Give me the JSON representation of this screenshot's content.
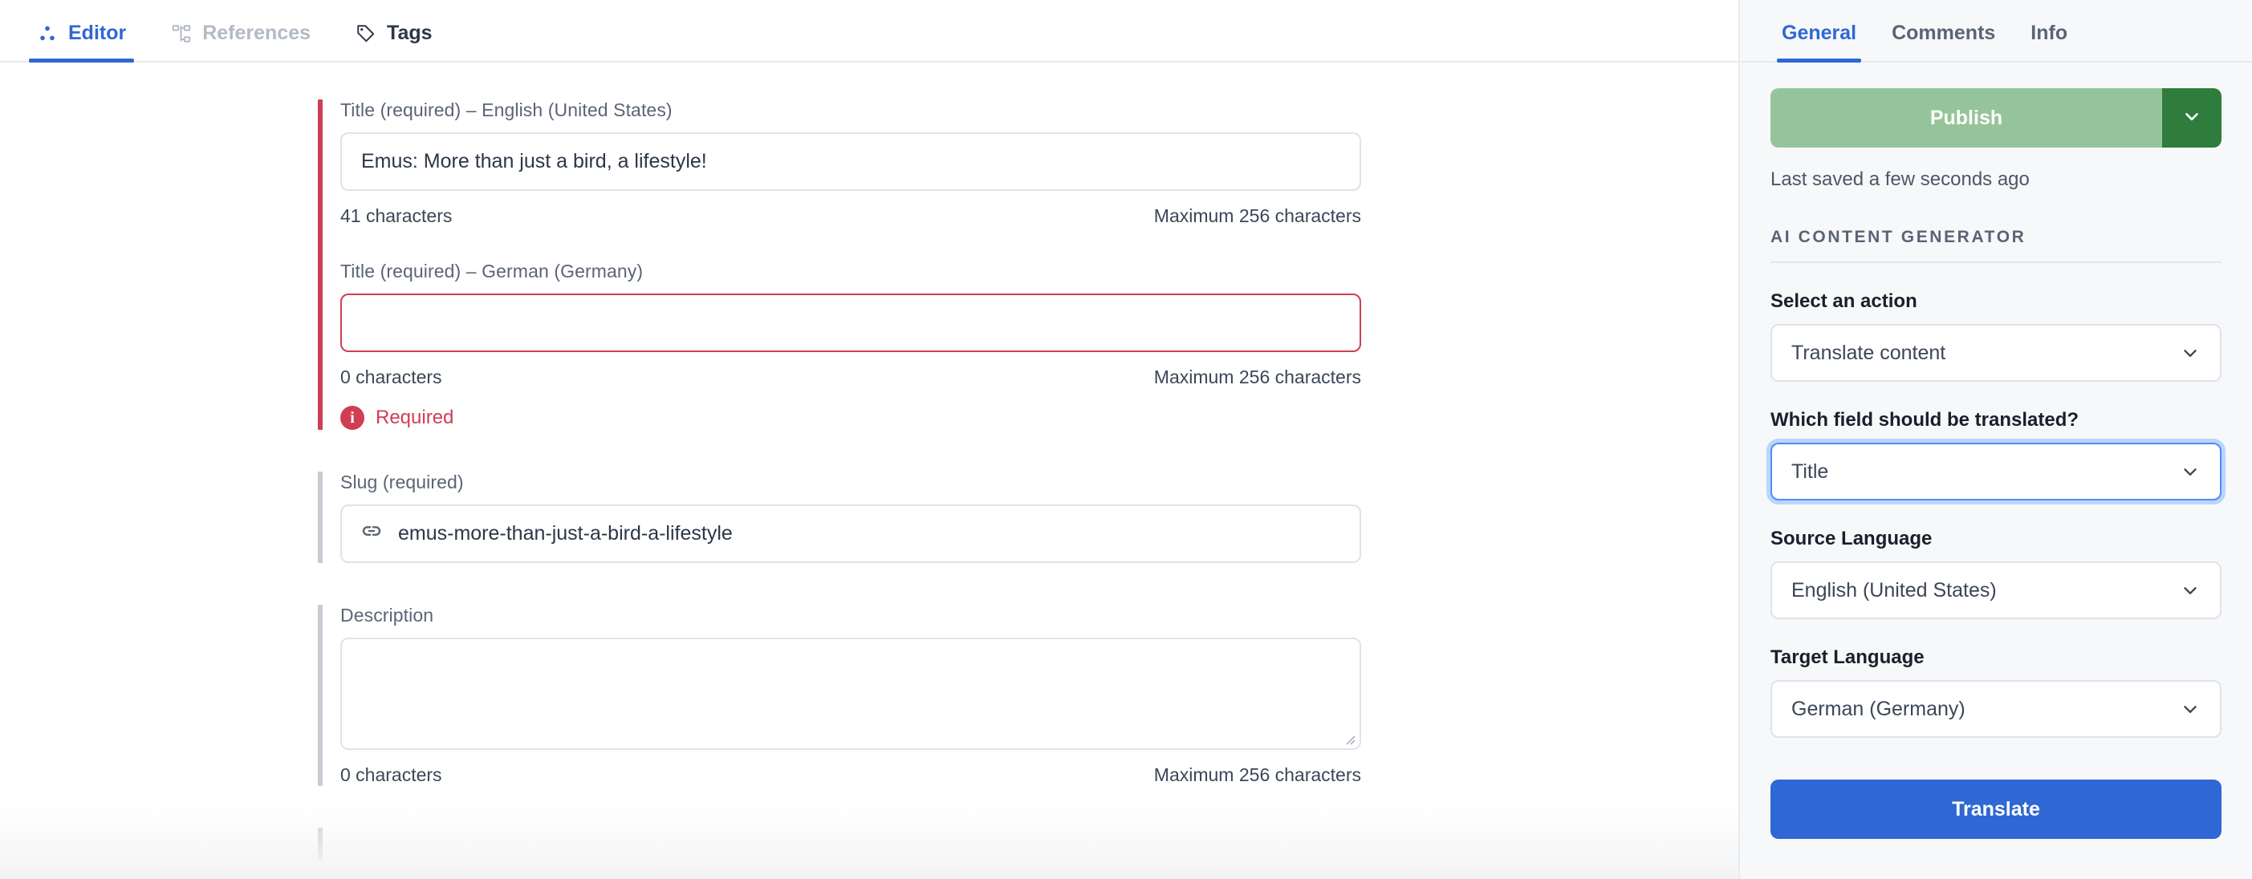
{
  "main": {
    "tabs": [
      {
        "label": "Editor",
        "icon": "editor-dots-icon",
        "state": "active"
      },
      {
        "label": "References",
        "icon": "references-sitemap-icon",
        "state": "disabled"
      },
      {
        "label": "Tags",
        "icon": "tag-icon",
        "state": "default"
      }
    ],
    "fields": {
      "title_en": {
        "label": "Title (required) – English (United States)",
        "value": "Emus: More than just a bird, a lifestyle!",
        "char_count": "41 characters",
        "max_chars": "Maximum 256 characters"
      },
      "title_de": {
        "label": "Title (required) – German (Germany)",
        "value": "",
        "char_count": "0 characters",
        "max_chars": "Maximum 256 characters",
        "error": "Required",
        "error_icon": "info-circle-icon"
      },
      "slug": {
        "label": "Slug (required)",
        "value": "emus-more-than-just-a-bird-a-lifestyle",
        "icon": "link-icon"
      },
      "description": {
        "label": "Description",
        "value": "",
        "char_count": "0 characters",
        "max_chars": "Maximum 256 characters"
      }
    }
  },
  "sidebar": {
    "tabs": [
      {
        "label": "General",
        "state": "active"
      },
      {
        "label": "Comments",
        "state": "default"
      },
      {
        "label": "Info",
        "state": "default"
      }
    ],
    "publish": {
      "label": "Publish",
      "caret_icon": "chevron-down-icon"
    },
    "saved_status": "Last saved a few seconds ago",
    "ai_section": {
      "heading": "AI CONTENT GENERATOR",
      "action": {
        "label": "Select an action",
        "value": "Translate content",
        "caret_icon": "chevron-down-icon"
      },
      "field": {
        "label": "Which field should be translated?",
        "value": "Title",
        "caret_icon": "chevron-down-icon"
      },
      "source_language": {
        "label": "Source Language",
        "value": "English (United States)",
        "caret_icon": "chevron-down-icon"
      },
      "target_language": {
        "label": "Target Language",
        "value": "German (Germany)",
        "caret_icon": "chevron-down-icon"
      },
      "translate_button": "Translate"
    }
  },
  "colors": {
    "accent_blue": "#2f67d4",
    "error_red": "#cf3e54",
    "publish_green": "#96c49a",
    "publish_green_dark": "#2f7d3c",
    "panel_bg": "#f7f8fa"
  }
}
